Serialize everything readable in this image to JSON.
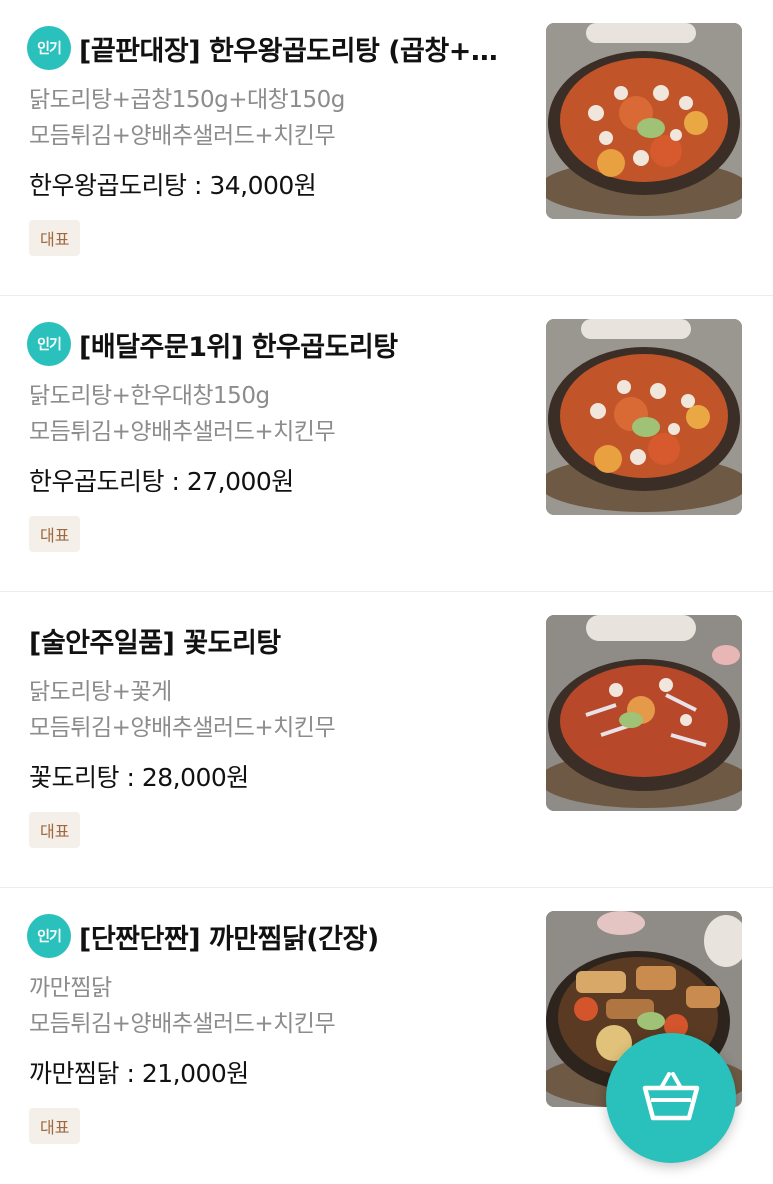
{
  "colors": {
    "accent": "#2ac1bc",
    "rep_badge_bg": "#f4efe9",
    "rep_badge_text": "#a0683e",
    "desc_text": "#8c8c8c"
  },
  "menu_items": [
    {
      "popular_label": "인기",
      "title": "[끝판대장] 한우왕곱도리탕 (곱창+대창)",
      "desc_lines": [
        "닭도리탕+곱창150g+대창150g",
        "모듬튀김+양배추샐러드+치킨무"
      ],
      "price": "한우왕곱도리탕 : 34,000원",
      "rep_label": "대표",
      "image_icon": "dakdoritang-photo"
    },
    {
      "popular_label": "인기",
      "title": "[배달주문1위] 한우곱도리탕",
      "desc_lines": [
        "닭도리탕+한우대창150g",
        "모듬튀김+양배추샐러드+치킨무"
      ],
      "price": "한우곱도리탕 : 27,000원",
      "rep_label": "대표",
      "image_icon": "dakdoritang-photo"
    },
    {
      "popular_label": "",
      "title": "[술안주일품] 꽃도리탕",
      "desc_lines": [
        "닭도리탕+꽃게",
        "모듬튀김+양배추샐러드+치킨무"
      ],
      "price": "꽃도리탕 : 28,000원",
      "rep_label": "대표",
      "image_icon": "crab-doritang-photo"
    },
    {
      "popular_label": "인기",
      "title": "[단짠단짠] 까만찜닭(간장)",
      "desc_lines": [
        "까만찜닭",
        "모듬튀김+양배추샐러드+치킨무"
      ],
      "price": "까만찜닭 : 21,000원",
      "rep_label": "대표",
      "image_icon": "jjimdak-photo"
    }
  ],
  "cart": {
    "icon": "basket-icon"
  }
}
